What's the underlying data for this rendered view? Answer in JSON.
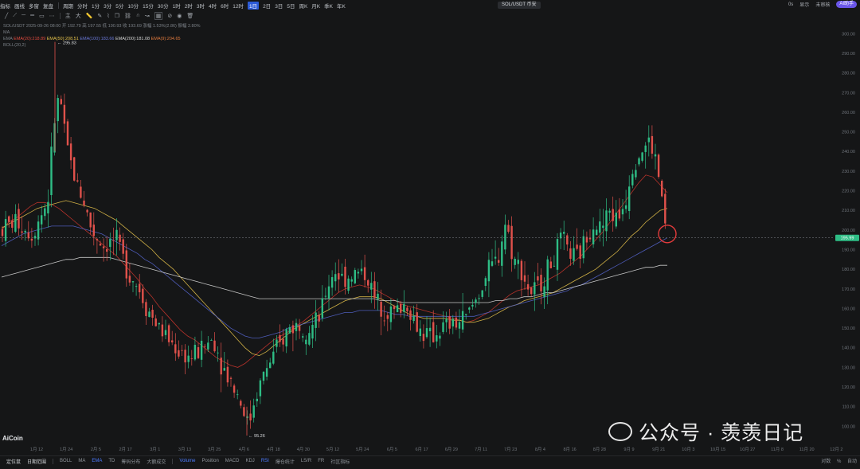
{
  "topbar": {
    "left_items": [
      "指标",
      "画线",
      "多窗",
      "复盘"
    ],
    "period_label": "周期",
    "timeframes": [
      "分时",
      "1分",
      "3分",
      "5分",
      "10分",
      "15分",
      "30分",
      "1时",
      "2时",
      "3时",
      "4时",
      "6时",
      "12时",
      "1日",
      "2日",
      "3日",
      "5日",
      "周K",
      "月K",
      "季K",
      "年K"
    ],
    "active_timeframe": "1日",
    "symbol_pill": "SOL/USDT 币安",
    "right_items": [
      "0s",
      "显示",
      "未审核"
    ],
    "ai_badge": "AI助手"
  },
  "toolbar2": {
    "icons": [
      "line-tool",
      "ray-tool",
      "horizontal-tool",
      "vertical-tool",
      "rect-tool",
      "more-tool",
      "zhu-tool",
      "da-tool",
      "ruler-tool",
      "pencil-tool",
      "text-tool",
      "grid-tool",
      "copy-tool",
      "link-tool",
      "magnet-tool",
      "brush-tool",
      "fib-tool",
      "chart-tool",
      "trash-tool"
    ],
    "labels": [
      "主",
      "大"
    ]
  },
  "legend": {
    "ohlc": "SOL/USDT  2025-09-26 08:00  开 192.79  高 197.55  低 190.93  收 193.69  涨幅 1.53%(2.86)  振幅 2.80%",
    "ma_label": "MA",
    "ema_label": "EMA",
    "ema_items": [
      {
        "text": "EMA(20):218.89",
        "color": "#e0493e"
      },
      {
        "text": "EMA(50):208.51",
        "color": "#e3c04a"
      },
      {
        "text": "EMA(100):183.66",
        "color": "#6a78d9"
      },
      {
        "text": "EMA(200):181.08",
        "color": "#d8d8d8"
      },
      {
        "text": "EMA(9):204.65",
        "color": "#e07a3e"
      }
    ],
    "boll_label": "BOLL(20,2)"
  },
  "chart_data": {
    "type": "candlestick",
    "symbol": "SOL/USDT",
    "ylim": [
      90,
      305
    ],
    "yticks": [
      100,
      110,
      120,
      130,
      140,
      150,
      160,
      170,
      180,
      190,
      200,
      210,
      220,
      230,
      240,
      250,
      260,
      270,
      280,
      290,
      300
    ],
    "x_labels": [
      "1月 12",
      "1月 24",
      "2月 5",
      "2月 17",
      "3月 1",
      "3月 13",
      "3月 25",
      "4月 6",
      "4月 18",
      "4月 30",
      "5月 12",
      "5月 24",
      "6月 5",
      "6月 17",
      "6月 29",
      "7月 11",
      "7月 23",
      "8月 4",
      "8月 16",
      "8月 28",
      "9月 9",
      "9月 21",
      "10月 3",
      "10月 15",
      "10月 27",
      "11月 8",
      "11月 20",
      "12月 2"
    ],
    "last_price": 195.99,
    "last_price_label": "195.99",
    "high_marker": {
      "label": "295.83",
      "value": 295.83
    },
    "low_marker": {
      "label": "95.26",
      "value": 95.26
    },
    "series": [
      {
        "name": "EMA(20)",
        "color": "#c9352c",
        "values": [
          200,
          204,
          206,
          209,
          212,
          214,
          214,
          213,
          211,
          208,
          205,
          202,
          199,
          196,
          193,
          190,
          187,
          183,
          179,
          175,
          170,
          166,
          161,
          157,
          153,
          149,
          146,
          144,
          141,
          138,
          135,
          133,
          131,
          130,
          132,
          135,
          138,
          141,
          144,
          146,
          148,
          151,
          153,
          156,
          159,
          162,
          165,
          168,
          170,
          171,
          172,
          171,
          170,
          168,
          166,
          164,
          162,
          161,
          160,
          159,
          158,
          157,
          156,
          155,
          154,
          153,
          154,
          156,
          158,
          161,
          164,
          167,
          169,
          170,
          171,
          172,
          174,
          176,
          178,
          181,
          184,
          187,
          191,
          195,
          199,
          204,
          209,
          214,
          219,
          224,
          228,
          227,
          223,
          219
        ]
      },
      {
        "name": "EMA(50)",
        "color": "#e3c04a",
        "values": [
          201,
          203,
          205,
          207,
          209,
          211,
          212,
          213,
          214,
          215,
          214,
          213,
          212,
          211,
          209,
          207,
          205,
          202,
          199,
          196,
          193,
          190,
          186,
          183,
          180,
          176,
          172,
          168,
          164,
          160,
          156,
          152,
          148,
          144,
          140,
          137,
          136,
          138,
          141,
          144,
          147,
          150,
          152,
          154,
          156,
          158,
          160,
          162,
          164,
          165,
          166,
          166,
          166,
          165,
          163,
          161,
          159,
          157,
          156,
          155,
          155,
          155,
          155,
          154,
          154,
          153,
          153,
          154,
          155,
          157,
          159,
          161,
          162,
          164,
          165,
          166,
          167,
          168,
          170,
          172,
          174,
          176,
          178,
          180,
          183,
          186,
          189,
          193,
          197,
          200,
          204,
          207,
          210,
          211
        ]
      },
      {
        "name": "EMA(100)",
        "color": "#5363c9",
        "values": [
          192,
          194,
          196,
          198,
          199,
          200,
          201,
          202,
          202,
          202,
          202,
          201,
          200,
          199,
          198,
          196,
          194,
          192,
          190,
          188,
          185,
          183,
          180,
          177,
          174,
          171,
          168,
          165,
          162,
          159,
          156,
          153,
          150,
          148,
          146,
          145,
          145,
          146,
          147,
          148,
          150,
          151,
          152,
          153,
          154,
          155,
          156,
          157,
          158,
          158,
          159,
          159,
          159,
          159,
          158,
          157,
          157,
          156,
          156,
          156,
          156,
          156,
          156,
          156,
          156,
          156,
          156,
          157,
          158,
          159,
          160,
          161,
          162,
          163,
          164,
          165,
          166,
          167,
          168,
          169,
          171,
          172,
          174,
          176,
          178,
          180,
          182,
          184,
          186,
          188,
          190,
          192,
          194,
          196
        ]
      },
      {
        "name": "EMA(200)",
        "color": "#d8d8d8",
        "values": [
          176,
          177,
          178,
          179,
          180,
          181,
          182,
          183,
          184,
          185,
          185,
          186,
          186,
          186,
          186,
          186,
          185,
          184,
          183,
          182,
          181,
          180,
          179,
          178,
          177,
          176,
          175,
          174,
          173,
          172,
          171,
          170,
          169,
          168,
          167,
          166,
          165,
          165,
          165,
          165,
          165,
          165,
          165,
          165,
          165,
          165,
          165,
          165,
          165,
          165,
          165,
          165,
          165,
          164,
          164,
          164,
          163,
          163,
          163,
          163,
          163,
          163,
          163,
          163,
          163,
          163,
          163,
          163,
          163,
          164,
          164,
          165,
          165,
          166,
          166,
          167,
          168,
          168,
          169,
          170,
          171,
          172,
          173,
          174,
          175,
          176,
          177,
          178,
          179,
          180,
          181,
          181,
          182,
          182
        ]
      }
    ]
  },
  "annotations": {
    "circle_label": ""
  },
  "bottombar": {
    "items": [
      "定位鼠",
      "日期范围",
      "BOLL",
      "MA",
      "EMA",
      "TD",
      "筹码分布",
      "大额成交",
      "Volume",
      "Position",
      "MACD",
      "KDJ",
      "RSI",
      "爆仓统计",
      "LS/R",
      "FR",
      "社区指标"
    ],
    "right_items": [
      "对数",
      "%",
      "自动"
    ]
  },
  "brand": "AiCoin",
  "watermark": "公众号 · 羡羡日记"
}
